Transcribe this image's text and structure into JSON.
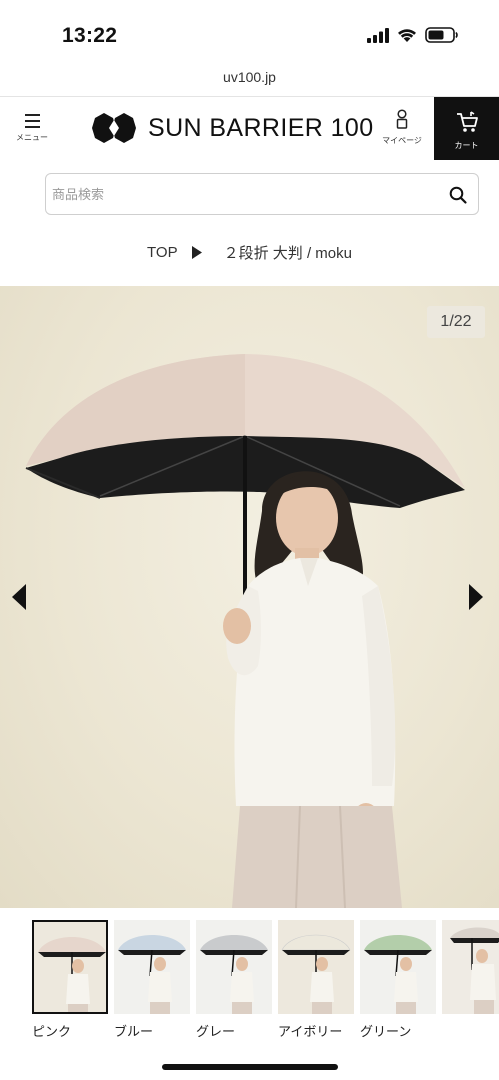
{
  "status_bar": {
    "time": "13:22"
  },
  "browser": {
    "url": "uv100.jp"
  },
  "header": {
    "menu_label": "メニュー",
    "brand": "SUN BARRIER 100",
    "mypage_label": "マイページ",
    "cart_label": "カート"
  },
  "search": {
    "placeholder": "商品検索",
    "value": ""
  },
  "breadcrumb": {
    "top": "TOP",
    "current": "２段折 大判 / moku"
  },
  "gallery": {
    "counter": "1/22",
    "current_index": 1,
    "total": 22
  },
  "thumbnails": [
    {
      "caption": "ピンク",
      "canopy_color": "#e6d6cc",
      "selected": true
    },
    {
      "caption": "ブルー",
      "canopy_color": "#c9d6e2",
      "selected": false
    },
    {
      "caption": "グレー",
      "canopy_color": "#c9cbcd",
      "selected": false
    },
    {
      "caption": "アイボリー",
      "canopy_color": "#ece8dc",
      "selected": false
    },
    {
      "caption": "グリーン",
      "canopy_color": "#b3ceaa",
      "selected": false
    },
    {
      "caption": "",
      "canopy_color": "#d9d2cb",
      "selected": false
    }
  ],
  "colors": {
    "cart_bg": "#111111",
    "hero_bg": "#ece6d3",
    "umbrella_canopy": "#e8d8cd",
    "umbrella_lining": "#1c1c1c"
  },
  "icons": [
    "signal-icon",
    "wifi-icon",
    "battery-icon",
    "menu-icon",
    "brand-logo-icon",
    "mypage-icon",
    "cart-icon",
    "search-icon",
    "breadcrumb-arrow-icon",
    "prev-arrow-icon",
    "next-arrow-icon"
  ]
}
